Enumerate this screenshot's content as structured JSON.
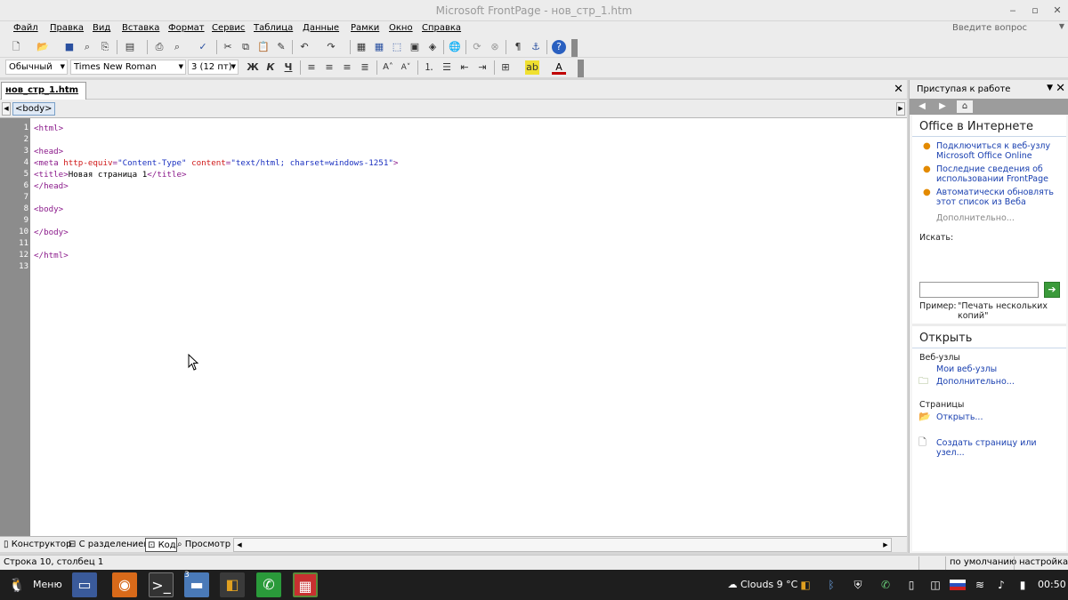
{
  "window": {
    "title": "Microsoft FrontPage - нов_стр_1.htm",
    "minimize_icon": "minimize-icon",
    "maximize_icon": "maximize-icon",
    "close_icon": "close-icon"
  },
  "menu": {
    "items": [
      "Файл",
      "Правка",
      "Вид",
      "Вставка",
      "Формат",
      "Сервис",
      "Таблица",
      "Данные",
      "Рамки",
      "Окно",
      "Справка"
    ],
    "ask_placeholder": "Введите вопрос"
  },
  "format_toolbar": {
    "style": "Обычный",
    "font": "Times New Roman",
    "size": "3 (12 пт)",
    "bold": "Ж",
    "italic": "К",
    "underline": "Ч",
    "grow_font": "A˄",
    "shrink_font": "A˅"
  },
  "doc": {
    "tab": "нов_стр_1.htm",
    "tag": "<body>"
  },
  "code": {
    "line_numbers": [
      "1",
      "2",
      "3",
      "4",
      "5",
      "6",
      "7",
      "8",
      "9",
      "10",
      "11",
      "12",
      "13"
    ],
    "l1": "<html>",
    "l3": "<head>",
    "l4a": "<meta ",
    "l4b": "http-equiv",
    "l4c": "=",
    "l4d": "\"Content-Type\"",
    "l4e": " content",
    "l4f": "=",
    "l4g": "\"text/html; charset=windows-1251\"",
    "l4h": ">",
    "l5a": "<title>",
    "l5b": "Новая страница 1",
    "l5c": "</title>",
    "l6": "</head>",
    "l8": "<body>",
    "l10": "</body>",
    "l12": "</html>"
  },
  "views": {
    "design": "Конструктор",
    "split": "С разделением",
    "code": "Код",
    "preview": "Просмотр"
  },
  "status": {
    "position": "Строка 10, столбец 1",
    "default": "по умолчанию",
    "settings": "настройка"
  },
  "pane": {
    "title": "Приступая к работе",
    "online_heading": "Office в Интернете",
    "online_links": [
      "Подключиться к веб-узлу Microsoft Office Online",
      "Последние сведения об использовании FrontPage",
      "Автоматически обновлять этот список из Веба"
    ],
    "more": "Дополнительно...",
    "search_label": "Искать:",
    "example_label": "Пример:",
    "example_text": "\"Печать нескольких копий\"",
    "open_heading": "Открыть",
    "websites_label": "Веб-узлы",
    "my_websites": "Мои веб-узлы",
    "websites_more": "Дополнительно...",
    "pages_label": "Страницы",
    "open_link": "Открыть...",
    "create_link": "Создать страницу или узел..."
  },
  "taskbar": {
    "menu": "Меню",
    "weather": "Clouds 9 °C",
    "time": "00:50",
    "files_badge": "3"
  }
}
